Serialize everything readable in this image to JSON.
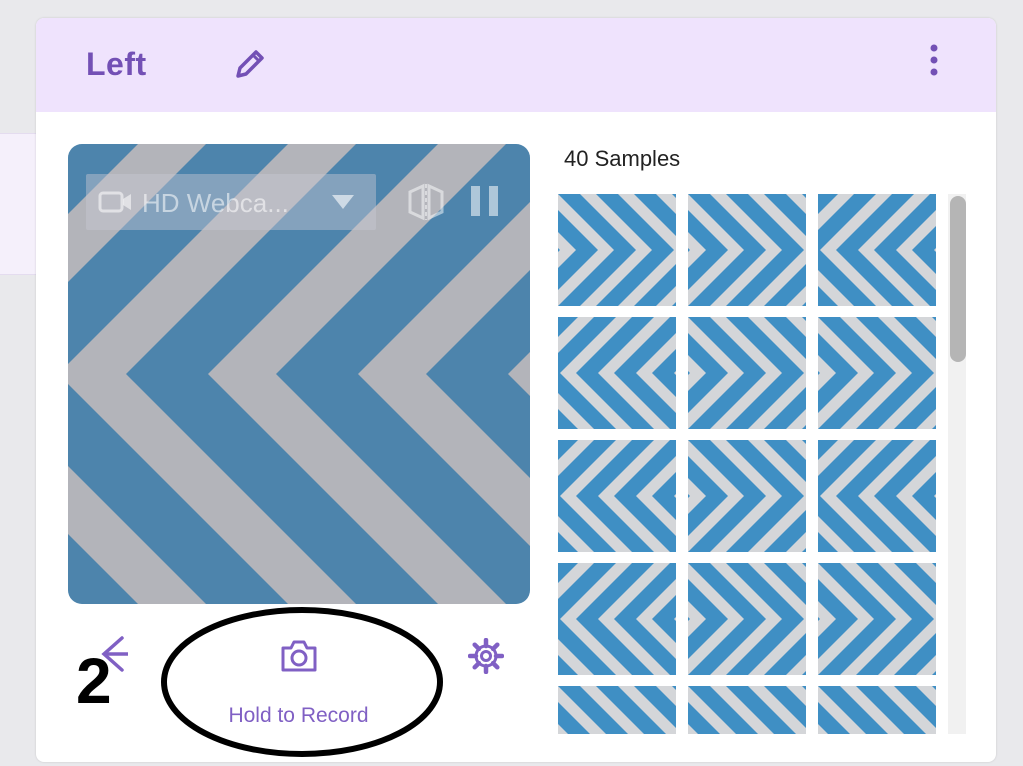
{
  "class_card": {
    "title": "Left",
    "edit_icon": "pencil-icon",
    "menu_icon": "more-vertical-icon",
    "accent_color": "#7350b5",
    "header_bg": "#efe3fd"
  },
  "webcam": {
    "device_label": "HD Webca...",
    "device_icon": "video-camera-icon",
    "flip_icon": "flip-horizontal-icon",
    "pause_icon": "pause-icon",
    "stripe_colors": [
      "#3f8fc4",
      "#d4d6d9"
    ]
  },
  "controls": {
    "back_icon": "arrow-left-icon",
    "capture_icon": "camera-icon",
    "record_label": "Hold to Record",
    "settings_icon": "gear-icon"
  },
  "annotation": {
    "step_number": "2"
  },
  "samples": {
    "count_label": "40 Samples",
    "thumbnails": [
      {
        "orient": "right"
      },
      {
        "orient": "right"
      },
      {
        "orient": "left"
      },
      {
        "orient": "left"
      },
      {
        "orient": "right"
      },
      {
        "orient": "right"
      },
      {
        "orient": "left"
      },
      {
        "orient": "right"
      },
      {
        "orient": "left"
      },
      {
        "orient": "left"
      },
      {
        "orient": "right"
      },
      {
        "orient": "right"
      },
      {
        "orient": "right"
      },
      {
        "orient": "right"
      },
      {
        "orient": "right"
      }
    ]
  }
}
